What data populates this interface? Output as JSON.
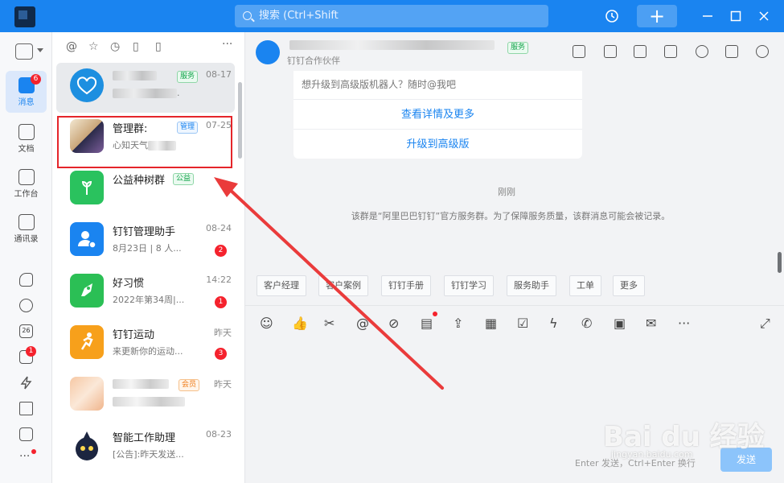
{
  "search": {
    "placeholder": "搜索 (Ctrl+Shift"
  },
  "nav": {
    "items": [
      {
        "label": "消息",
        "badge": "6"
      },
      {
        "label": "文档"
      },
      {
        "label": "工作台"
      },
      {
        "label": "通讯录"
      }
    ],
    "calendar_day": "26",
    "todo_badge": "1"
  },
  "filters": {
    "more": "···"
  },
  "conversations": [
    {
      "name": "",
      "tag": "服务",
      "time": "08-17",
      "preview": "."
    },
    {
      "name": "管理群:",
      "tag": "管理",
      "time": "07-25",
      "preview": "心知天气"
    },
    {
      "name": "公益种树群",
      "tag": "公益",
      "time": "",
      "preview": ""
    },
    {
      "name": "钉钉管理助手",
      "time": "08-24",
      "preview": "8月23日 | 8 人...",
      "badge": "2"
    },
    {
      "name": "好习惯",
      "time": "14:22",
      "preview": "2022年第34周|...",
      "badge": "1"
    },
    {
      "name": "钉钉运动",
      "time": "昨天",
      "preview": "来更新你的运动...",
      "badge": "3"
    },
    {
      "name": "",
      "tag": "会员",
      "time": "昨天",
      "preview": ""
    },
    {
      "name": "智能工作助理",
      "time": "08-23",
      "preview": "[公告]:昨天发送..."
    }
  ],
  "chat": {
    "title": "",
    "title_tag": "服务",
    "subtitle": "钉钉合作伙伴",
    "card": {
      "question": "想升级到高级版机器人？随时@我吧",
      "link1": "查看详情及更多",
      "link2": "升级到高级版"
    },
    "time": "刚刚",
    "system_message": "该群是“阿里巴巴钉钉”官方服务群。为了保障服务质量，该群消息可能会被记录。",
    "quick_replies": [
      "客户经理",
      "客户案例",
      "钉钉手册",
      "钉钉学习",
      "服务助手",
      "工单",
      "更多"
    ],
    "hint": "Enter 发送，Ctrl+Enter 换行",
    "send": "发送"
  },
  "watermark": {
    "main": "Bai du 经验",
    "sub": "jingyan.baidu.com"
  }
}
